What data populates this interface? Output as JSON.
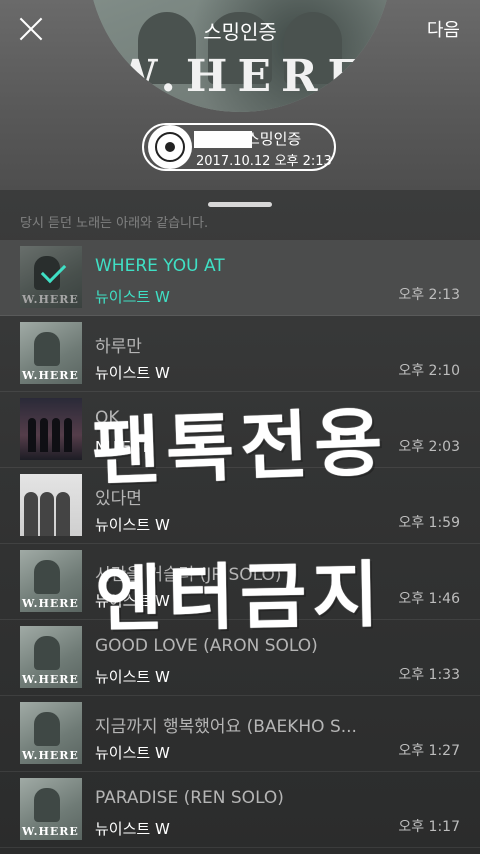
{
  "header": {
    "close_icon": "close-icon",
    "next_label": "다음",
    "cover_title": "스밍인증",
    "cover_logo": "W.HERE",
    "certificate": {
      "icon": "disc-icon",
      "label": "스밍인증",
      "date": "2017.10.12 오후 2:13"
    }
  },
  "list": {
    "faded_text": "당시 듣던 노래는 아래와 같습니다.",
    "items": [
      {
        "title": "WHERE YOU AT",
        "artist": "뉴이스트 W",
        "time": "오후 2:13",
        "selected": true
      },
      {
        "title": "하루만",
        "artist": "뉴이스트 W",
        "time": "오후 2:10"
      },
      {
        "title": "OK",
        "artist": "NU'EST",
        "time": "오후 2:03"
      },
      {
        "title": "있다면",
        "artist": "뉴이스트 W",
        "time": "오후 1:59"
      },
      {
        "title": "시간을 거슬러 (JR SOLO)",
        "artist": "뉴이스트 W",
        "time": "오후 1:46"
      },
      {
        "title": "GOOD LOVE (ARON SOLO)",
        "artist": "뉴이스트 W",
        "time": "오후 1:33"
      },
      {
        "title": "지금까지 행복했어요 (BAEKHO S...",
        "artist": "뉴이스트 W",
        "time": "오후 1:27"
      },
      {
        "title": "PARADISE (REN SOLO)",
        "artist": "뉴이스트 W",
        "time": "오후 1:17"
      }
    ]
  },
  "overlay": {
    "line1": "팬톡전용",
    "line2": "엔터금지"
  },
  "colors": {
    "accent": "#3fe0c5",
    "background": "#3a3b3b"
  }
}
